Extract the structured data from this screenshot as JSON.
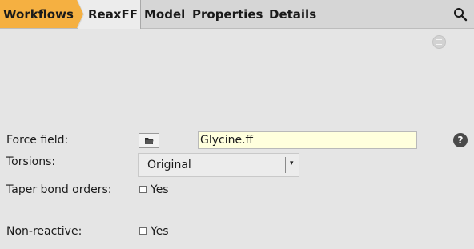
{
  "nav": {
    "crumbs": [
      "Workflows",
      "ReaxFF"
    ],
    "menu": [
      "Model",
      "Properties",
      "Details"
    ],
    "search_icon": "magnifier"
  },
  "panel": {
    "menu_icon": "hamburger",
    "force_field": {
      "label": "Force field:",
      "value": "Glycine.ff",
      "browse_icon": "folder",
      "help": "?"
    },
    "torsions": {
      "label": "Torsions:",
      "selected": "Original",
      "arrow": "▾"
    },
    "taper_bond_orders": {
      "label": "Taper bond orders:",
      "option": "Yes",
      "checked": false
    },
    "non_reactive": {
      "label": "Non-reactive:",
      "option": "Yes",
      "checked": false
    }
  },
  "colors": {
    "workflows_crumb": "#f5b041",
    "input_background": "#ffffdd",
    "page_background": "#e5e5e5"
  }
}
